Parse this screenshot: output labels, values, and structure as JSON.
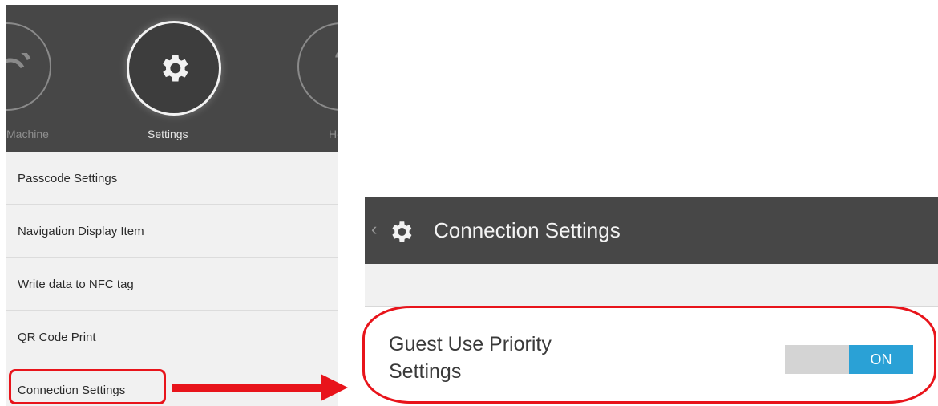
{
  "carousel": {
    "machine_label": "Machine",
    "settings_label": "Settings",
    "help_label": "Help"
  },
  "menu": {
    "items": [
      {
        "label": "Passcode Settings"
      },
      {
        "label": "Navigation Display Item"
      },
      {
        "label": "Write data to NFC tag"
      },
      {
        "label": "QR Code Print"
      },
      {
        "label": "Connection Settings"
      }
    ]
  },
  "connection_screen": {
    "back_glyph": "‹",
    "title": "Connection Settings",
    "setting_label": "Guest Use Priority Settings",
    "toggle_state": "ON"
  },
  "colors": {
    "header": "#474747",
    "highlight": "#e8141b",
    "toggle_on": "#2aa1d6"
  },
  "icons": {
    "carousel": [
      "wifi-icon",
      "gear-icon",
      "help-icon"
    ],
    "header": [
      "chevron-left-icon",
      "gear-icon"
    ]
  }
}
